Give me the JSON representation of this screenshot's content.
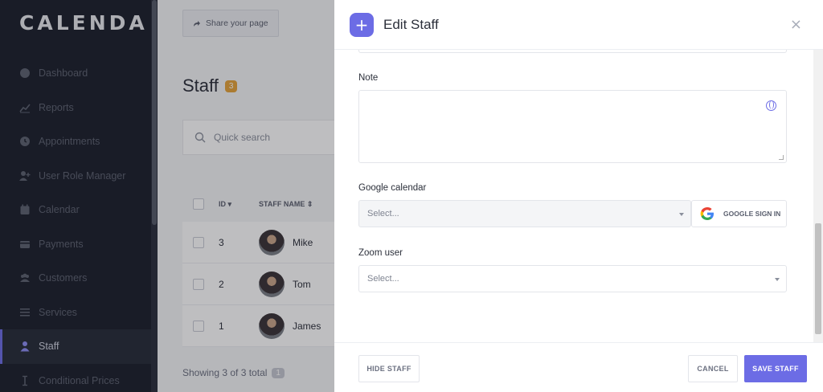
{
  "app": {
    "logo": "CALENDA"
  },
  "sidebar": {
    "items": [
      {
        "label": "Dashboard",
        "icon": "dashboard-icon"
      },
      {
        "label": "Reports",
        "icon": "chart-icon"
      },
      {
        "label": "Appointments",
        "icon": "clock-icon"
      },
      {
        "label": "User Role Manager",
        "icon": "user-plus-icon"
      },
      {
        "label": "Calendar",
        "icon": "calendar-icon"
      },
      {
        "label": "Payments",
        "icon": "wallet-icon"
      },
      {
        "label": "Customers",
        "icon": "users-icon"
      },
      {
        "label": "Services",
        "icon": "list-icon"
      },
      {
        "label": "Staff",
        "icon": "user-icon",
        "active": true
      },
      {
        "label": "Conditional Prices",
        "icon": "cursor-icon"
      }
    ]
  },
  "main": {
    "share_label": "Share your page",
    "title": "Staff",
    "count": "3",
    "search_placeholder": "Quick search",
    "columns": {
      "id": "ID",
      "name": "STAFF NAME"
    },
    "rows": [
      {
        "id": "3",
        "name": "Mike"
      },
      {
        "id": "2",
        "name": "Tom"
      },
      {
        "id": "1",
        "name": "James"
      }
    ],
    "showing": "Showing 3 of 3 total",
    "showing_count": "1"
  },
  "panel": {
    "title": "Edit Staff",
    "plus": "+",
    "close": "×",
    "note_label": "Note",
    "google_label": "Google calendar",
    "google_placeholder": "Select...",
    "google_signin": "GOOGLE SIGN IN",
    "zoom_label": "Zoom user",
    "zoom_placeholder": "Select...",
    "hide_label": "HIDE STAFF",
    "cancel_label": "CANCEL",
    "save_label": "SAVE STAFF"
  },
  "colors": {
    "accent": "#6c6ce5",
    "sidebar": "#1b1f2b",
    "badge": "#e5a23a"
  }
}
